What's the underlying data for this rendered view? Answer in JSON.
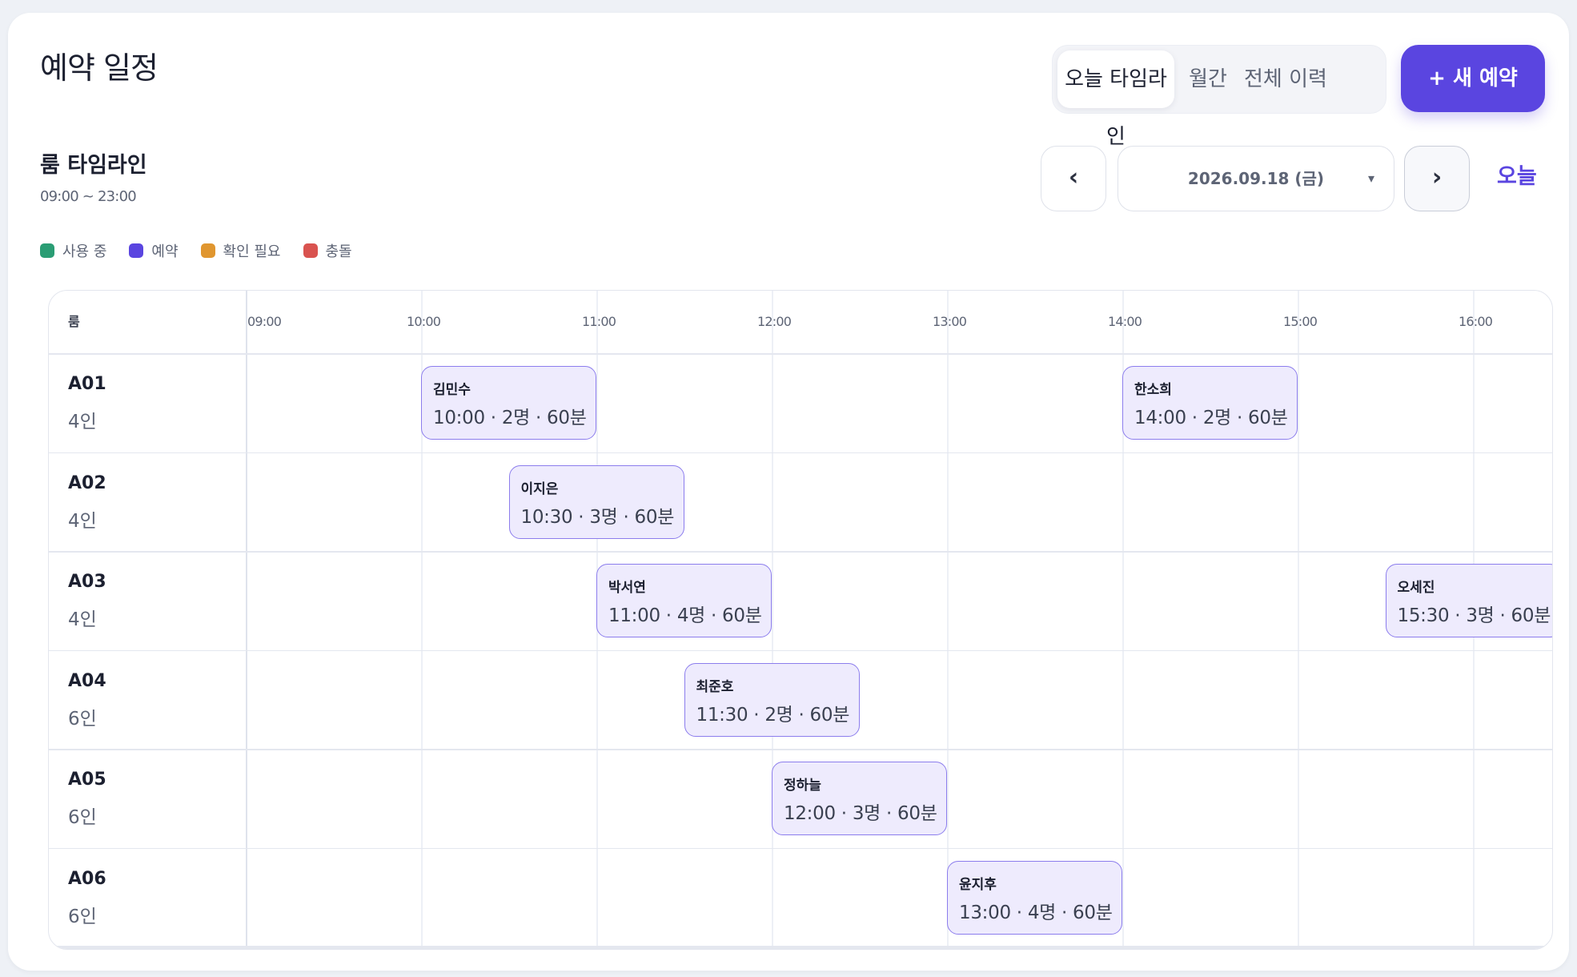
{
  "header": {
    "title": "예약 일정",
    "tabs": [
      {
        "label": "오늘 타임라인",
        "active": true
      },
      {
        "label": "월간",
        "active": false
      },
      {
        "label": "전체 이력",
        "active": false
      }
    ],
    "new_button": "+ 새 예약"
  },
  "section": {
    "title": "룸 타임라인",
    "range": "09:00 ~ 23:00"
  },
  "date_nav": {
    "prev": "‹",
    "date": "2026.09.18 (금)",
    "caret": "▾",
    "next": "›",
    "today": "오늘"
  },
  "legend": [
    {
      "label": "사용 중",
      "color": "#2a9d74"
    },
    {
      "label": "예약",
      "color": "#5a45e0"
    },
    {
      "label": "확인 필요",
      "color": "#e0962f"
    },
    {
      "label": "충돌",
      "color": "#d9534f"
    }
  ],
  "timeline": {
    "room_header": "룸",
    "hours": [
      "09:00",
      "10:00",
      "11:00",
      "12:00",
      "13:00",
      "14:00",
      "15:00",
      "16:00"
    ],
    "rooms": [
      {
        "id": "A01",
        "capacity": "4인"
      },
      {
        "id": "A02",
        "capacity": "4인"
      },
      {
        "id": "A03",
        "capacity": "4인"
      },
      {
        "id": "A04",
        "capacity": "6인"
      },
      {
        "id": "A05",
        "capacity": "6인"
      },
      {
        "id": "A06",
        "capacity": "6인"
      }
    ],
    "events": [
      {
        "room": 0,
        "name": "김민수",
        "start": "10:00",
        "detail": "10:00 · 2명 · 60분",
        "duration_min": 60
      },
      {
        "room": 0,
        "name": "한소희",
        "start": "14:00",
        "detail": "14:00 · 2명 · 60분",
        "duration_min": 60
      },
      {
        "room": 1,
        "name": "이지은",
        "start": "10:30",
        "detail": "10:30 · 3명 · 60분",
        "duration_min": 60
      },
      {
        "room": 2,
        "name": "박서연",
        "start": "11:00",
        "detail": "11:00 · 4명 · 60분",
        "duration_min": 60
      },
      {
        "room": 2,
        "name": "오세진",
        "start": "15:30",
        "detail": "15:30 · 3명 · 60분",
        "duration_min": 60
      },
      {
        "room": 3,
        "name": "최준호",
        "start": "11:30",
        "detail": "11:30 · 2명 · 60분",
        "duration_min": 60
      },
      {
        "room": 4,
        "name": "정하늘",
        "start": "12:00",
        "detail": "12:00 · 3명 · 60분",
        "duration_min": 60
      },
      {
        "room": 5,
        "name": "윤지후",
        "start": "13:00",
        "detail": "13:00 · 4명 · 60분",
        "duration_min": 60
      }
    ]
  }
}
